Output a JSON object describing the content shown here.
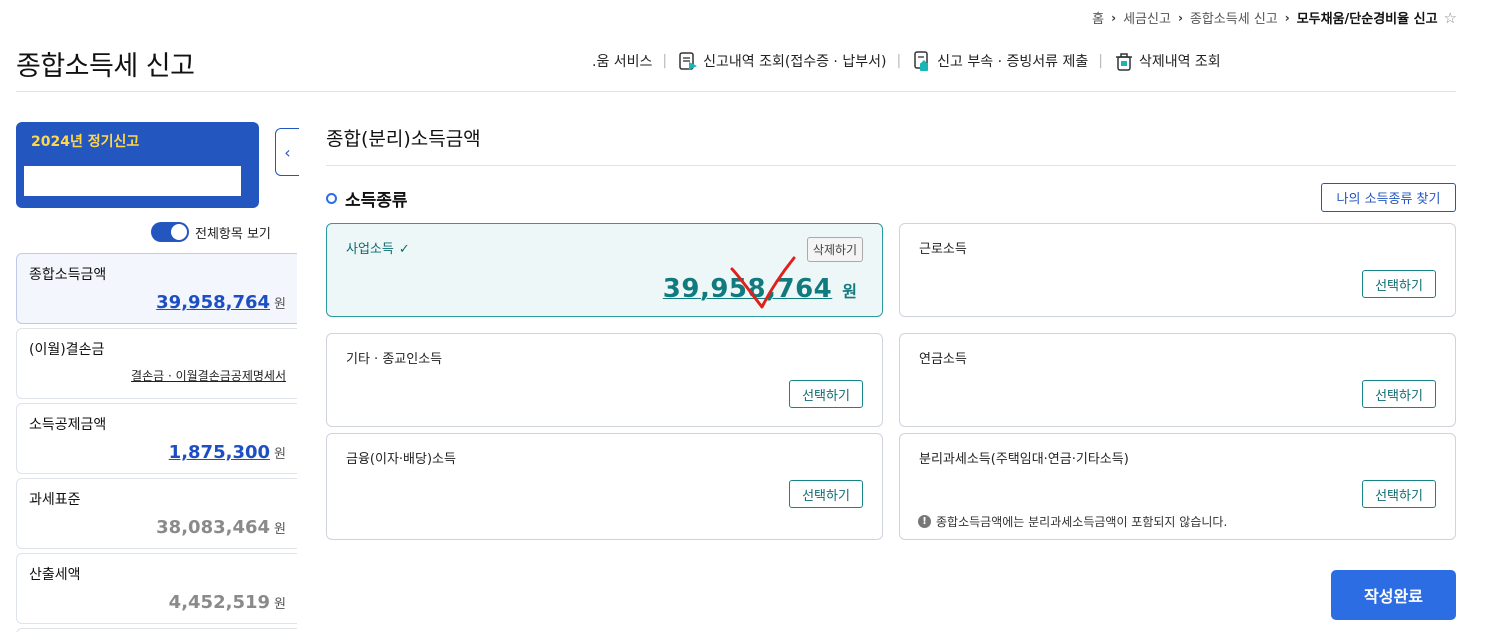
{
  "breadcrumb": {
    "items": [
      "홈",
      "세금신고",
      "종합소득세 신고"
    ],
    "current": "모두채움/단순경비율 신고"
  },
  "header": {
    "title": "종합소득세 신고",
    "links": [
      {
        "label": ".움 서비스",
        "icon": "none"
      },
      {
        "label": "신고내역 조회(접수증 · 납부서)",
        "icon": "document-list-icon"
      },
      {
        "label": "신고 부속 · 증빙서류 제출",
        "icon": "document-upload-icon"
      },
      {
        "label": "삭제내역 조회",
        "icon": "trash-icon"
      }
    ]
  },
  "sidebar": {
    "year_title": "2024년 정기신고",
    "toggle_label": "전체항목 보기",
    "items": [
      {
        "label": "종합소득금액",
        "value": "39,958,764",
        "unit": "원"
      },
      {
        "label": "(이월)결손금",
        "sub_link": "결손금 · 이월결손금공제명세서"
      },
      {
        "label": "소득공제금액",
        "value": "1,875,300",
        "unit": "원"
      },
      {
        "label": "과세표준",
        "value": "38,083,464",
        "unit": "원"
      },
      {
        "label": "산출세액",
        "value": "4,452,519",
        "unit": "원"
      }
    ]
  },
  "main": {
    "section_title": "종합(분리)소득금액",
    "sub_title": "소득종류",
    "find_button": "나의 소득종류 찾기",
    "select_label": "선택하기",
    "delete_label": "삭제하기",
    "cards": [
      {
        "label": "사업소득",
        "amount": "39,958,764",
        "unit": "원",
        "selected": true
      },
      {
        "label": "근로소득"
      },
      {
        "label": "기타 · 종교인소득"
      },
      {
        "label": "연금소득"
      },
      {
        "label": "금융(이자·배당)소득"
      },
      {
        "label": "분리과세소득(주택임대·연금·기타소득)",
        "note": "종합소득금액에는 분리과세소득금액이 포함되지 않습니다."
      }
    ],
    "submit_label": "작성완료"
  },
  "colors": {
    "primary": "#2456c0",
    "accent_teal": "#117a7e",
    "annotation_red": "#e0201a",
    "submit_blue": "#2c6de4"
  }
}
